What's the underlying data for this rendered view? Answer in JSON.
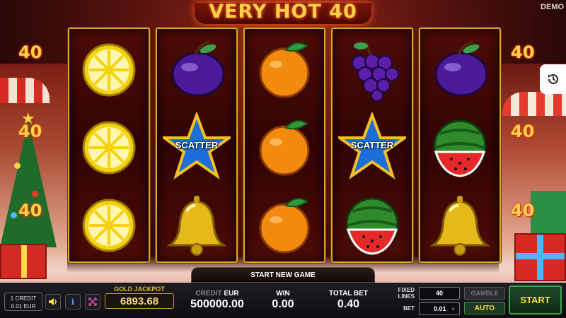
{
  "title": "VERY HOT 40",
  "mode_badge": "DEMO",
  "line_markers": {
    "left": [
      "40",
      "40",
      "40"
    ],
    "right": [
      "40",
      "40",
      "40"
    ]
  },
  "reels": [
    [
      "lemon",
      "lemon",
      "lemon"
    ],
    [
      "plum",
      "scatter",
      "bell"
    ],
    [
      "orange",
      "orange",
      "orange"
    ],
    [
      "grapes",
      "scatter",
      "watermelon"
    ],
    [
      "plum",
      "watermelon",
      "bell"
    ]
  ],
  "scatter_label": "SCATTER",
  "start_new_game": "START NEW GAME",
  "credit_box": {
    "line1": "1 CREDIT",
    "line2": "0.01 EUR"
  },
  "icons": {
    "sound": "speaker-icon",
    "info": "info-icon",
    "fullscreen": "fullscreen-icon",
    "replay": "history-icon"
  },
  "jackpot": {
    "label": "GOLD JACKPOT",
    "value": "6893.68"
  },
  "credit": {
    "label": "CREDIT",
    "currency": "EUR",
    "value": "500000.00"
  },
  "win": {
    "label": "WIN",
    "value": "0.00"
  },
  "total_bet": {
    "label": "TOTAL BET",
    "value": "0.40"
  },
  "fixed_lines": {
    "label_1": "FIXED",
    "label_2": "LINES",
    "value": "40"
  },
  "bet": {
    "label": "BET",
    "value": "0.01",
    "plus": "+"
  },
  "buttons": {
    "gamble": "GAMBLE",
    "auto": "AUTO",
    "start": "START"
  },
  "colors": {
    "gold": "#ffd14a",
    "reel_border": "#e0a51c",
    "start_green": "#3da34c"
  }
}
